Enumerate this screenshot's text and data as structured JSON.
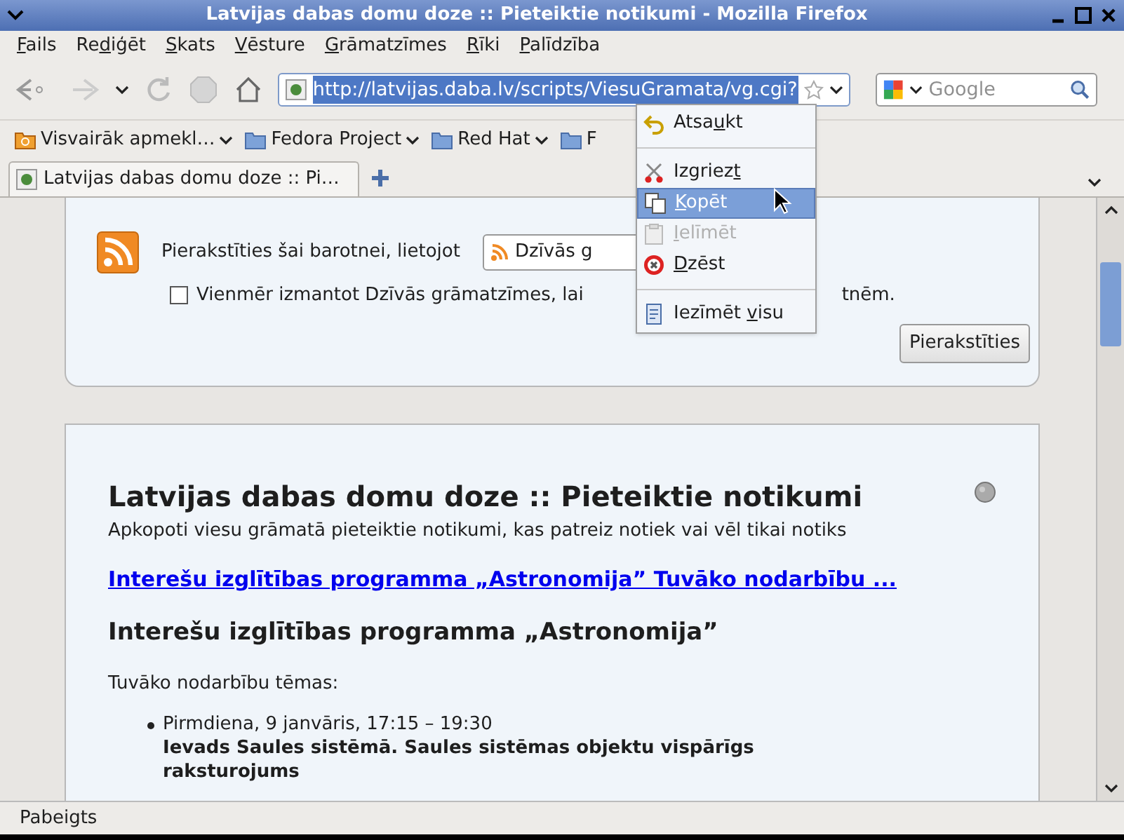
{
  "window": {
    "title": "Latvijas dabas domu doze :: Pieteiktie notikumi - Mozilla Firefox"
  },
  "menu_bar": [
    {
      "key": "F",
      "after": "ails"
    },
    {
      "before": "Re",
      "key": "d",
      "after": "iģēt"
    },
    {
      "key": "S",
      "after": "kats"
    },
    {
      "key": "V",
      "after": "ēsture"
    },
    {
      "key": "G",
      "after": "rāmatzīmes"
    },
    {
      "key": "R",
      "after": "īki"
    },
    {
      "key": "P",
      "after": "alīdzība"
    }
  ],
  "navigation": {
    "url": "http://latvijas.daba.lv/scripts/ViesuGramata/vg.cgi?",
    "search_placeholder": "Google"
  },
  "bookmarks": [
    {
      "label": "Visvairāk apmekl…",
      "kind": "smart"
    },
    {
      "label": "Fedora Project",
      "kind": "folder"
    },
    {
      "label": "Red Hat",
      "kind": "folder"
    },
    {
      "label": "F",
      "kind": "folder"
    }
  ],
  "tabs": [
    {
      "label": "Latvijas dabas domu doze :: Pi…",
      "selected": true
    }
  ],
  "feed_panel": {
    "subscribe_text": "Pierakstīties šai barotnei, lietojot",
    "reader": "Dzīvās g",
    "always_text": "Vienmēr izmantot Dzīvās grāmatzīmes, lai",
    "always_text_end": "tnēm.",
    "always_checked": false,
    "button": "Pierakstīties"
  },
  "context_menu": [
    {
      "kind": "undo",
      "before": "Atsa",
      "key": "u",
      "after": "kt",
      "disabled": false,
      "selected": false
    },
    {
      "kind": "separator"
    },
    {
      "kind": "cut",
      "before": "Izgriez",
      "key": "t",
      "disabled": false,
      "selected": false
    },
    {
      "kind": "copy",
      "key": "K",
      "after": "opēt",
      "disabled": false,
      "selected": true
    },
    {
      "kind": "paste",
      "key": "I",
      "after": "elīmēt",
      "disabled": true,
      "selected": false
    },
    {
      "kind": "delete",
      "key": "D",
      "after": "zēst",
      "disabled": false,
      "selected": false
    },
    {
      "kind": "separator"
    },
    {
      "kind": "selectall",
      "before": "Iezīmēt ",
      "key": "v",
      "after": "isu",
      "disabled": false,
      "selected": false
    }
  ],
  "page": {
    "title": "Latvijas dabas domu doze :: Pieteiktie notikumi",
    "subtitle": "Apkopoti viesu grāmatā pieteiktie notikumi, kas patreiz notiek vai vēl tikai notiks",
    "link": "Interešu izglītības programma „Astronomija” Tuvāko nodarbību ...",
    "heading": "Interešu izglītības programma „Astronomija”",
    "intro": "Tuvāko nodarbību tēmas:",
    "items": [
      {
        "date": "Pirmdiena, 9 janvāris, 17:15 – 19:30",
        "topic": "Ievads Saules sistēmā. Saules sistēmas objektu vispārīgs raksturojums"
      }
    ]
  },
  "status_bar": {
    "text": "Pabeigts"
  }
}
